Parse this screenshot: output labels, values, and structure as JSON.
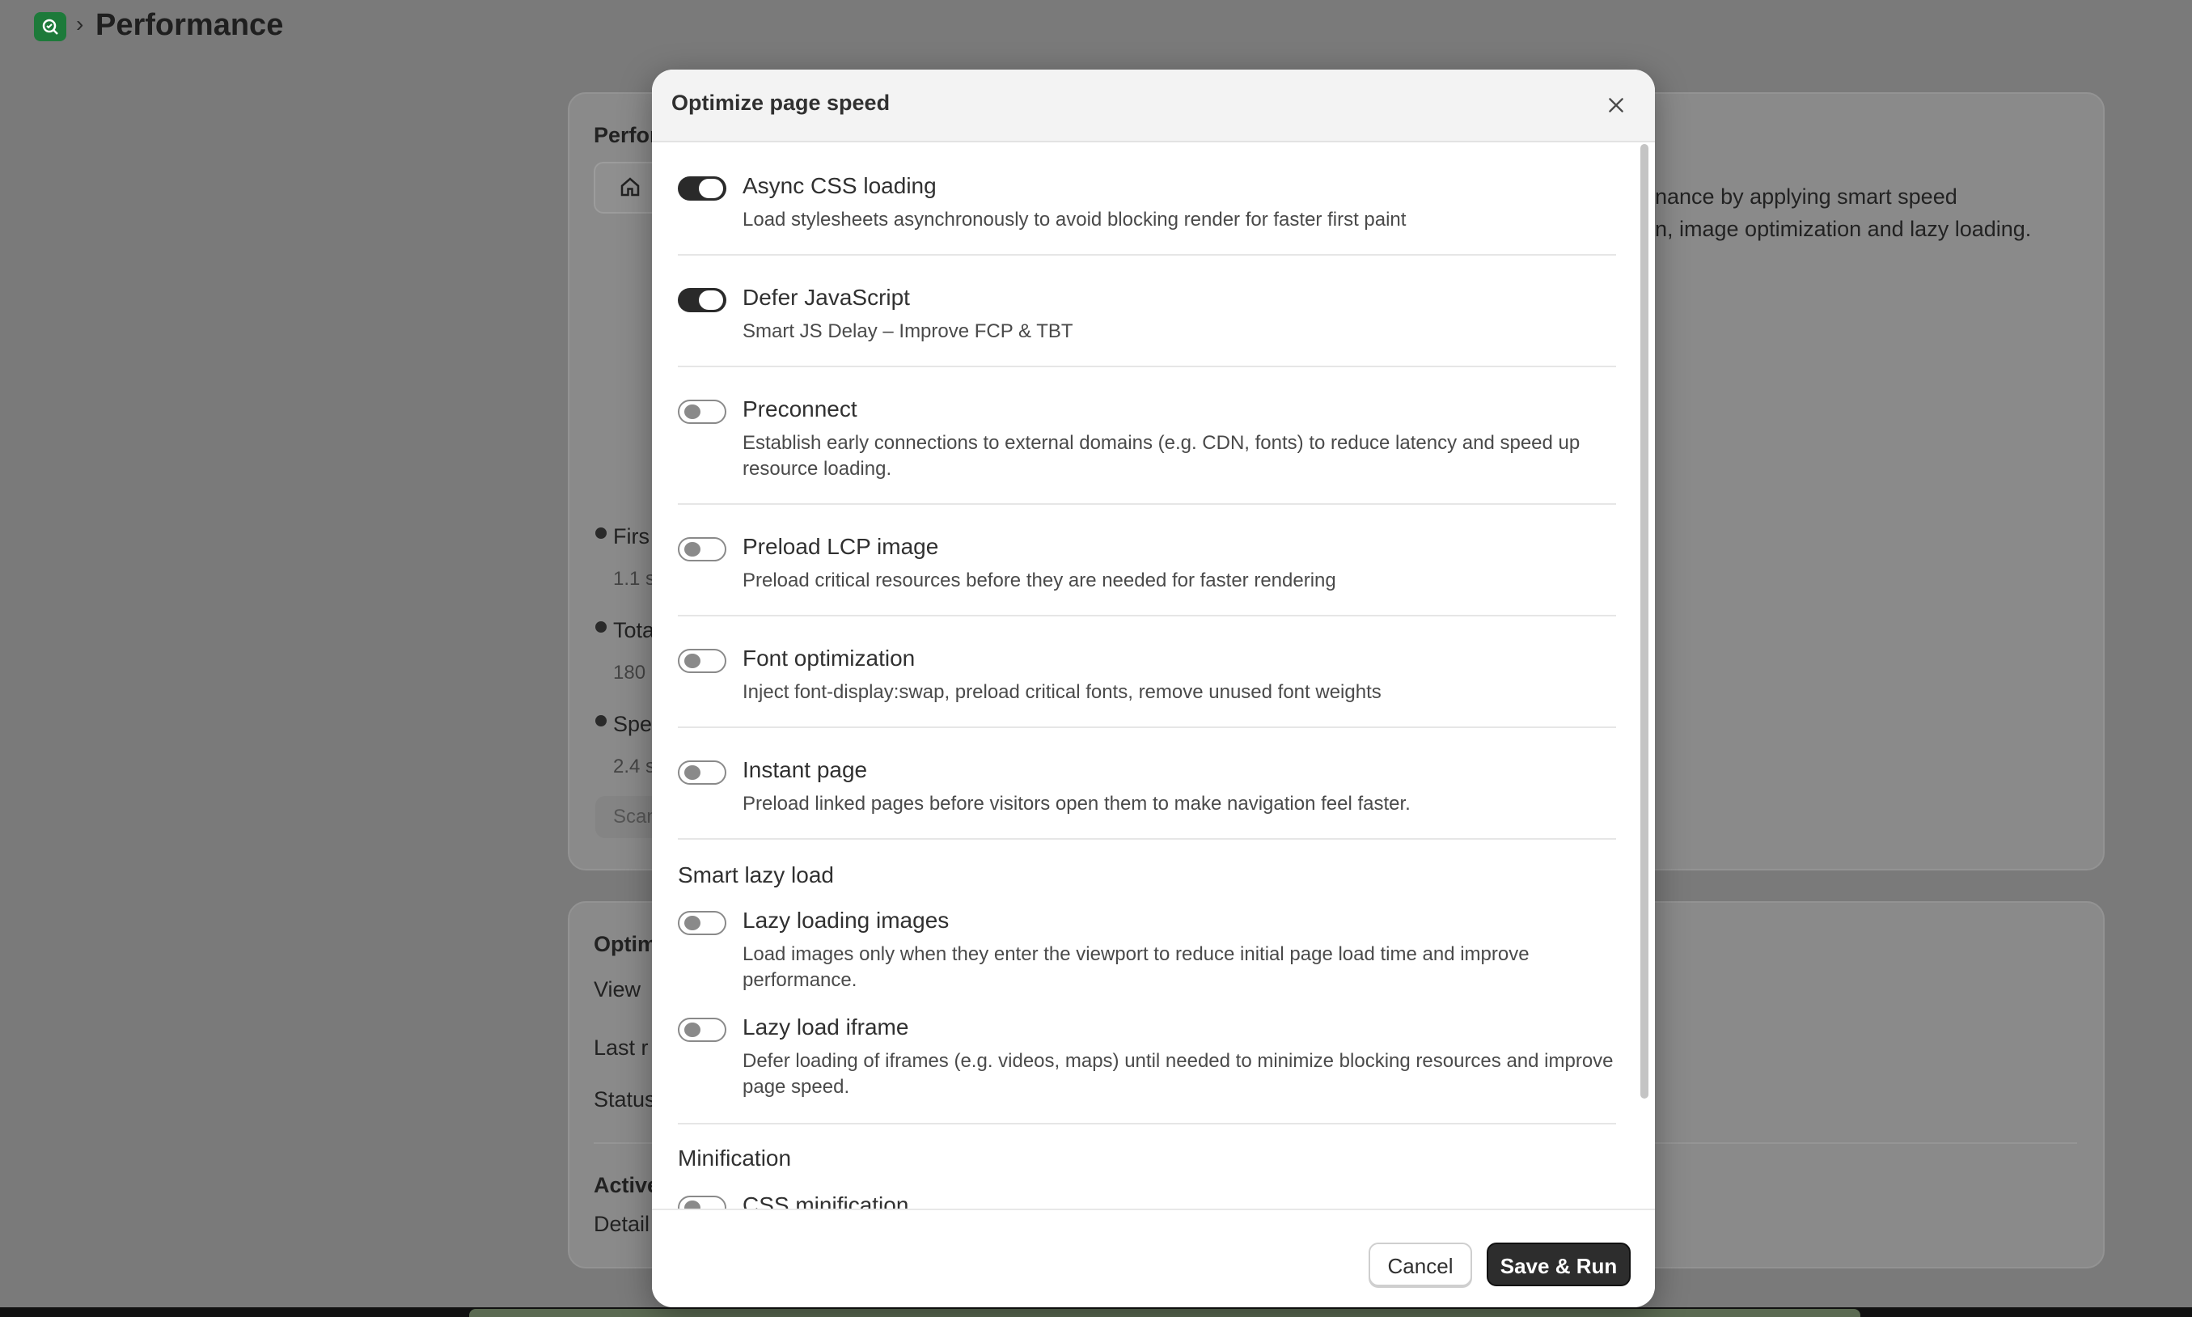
{
  "page": {
    "title": "Performance",
    "card1_title": "Perfor",
    "card1_desc_line1": "nance by applying smart speed",
    "card1_desc_line2": "n, image optimization and lazy loading.",
    "metrics": [
      {
        "label": "Firs",
        "value": "1.1 s"
      },
      {
        "label": "Tota",
        "value": "180"
      },
      {
        "label": "Spe",
        "value": "2.4 s"
      }
    ],
    "scan_button": "Scan",
    "card2_title": "Optim",
    "card2_view": "View",
    "last_run": "Last r",
    "status": "Status",
    "active": "Active",
    "details": "Detail"
  },
  "modal": {
    "title": "Optimize page speed",
    "options": [
      {
        "label": "Async CSS loading",
        "desc": "Load stylesheets asynchronously to avoid blocking render for faster first paint",
        "enabled": true
      },
      {
        "label": "Defer JavaScript",
        "desc": "Smart JS Delay – Improve FCP & TBT",
        "enabled": true
      },
      {
        "label": "Preconnect",
        "desc": "Establish early connections to external domains (e.g. CDN, fonts) to reduce latency and speed up resource loading.",
        "enabled": false
      },
      {
        "label": "Preload LCP image",
        "desc": "Preload critical resources before they are needed for faster rendering",
        "enabled": false
      },
      {
        "label": "Font optimization",
        "desc": "Inject font-display:swap, preload critical fonts, remove unused font weights",
        "enabled": false
      },
      {
        "label": "Instant page",
        "desc": "Preload linked pages before visitors open them to make navigation feel faster.",
        "enabled": false
      }
    ],
    "lazy_section": {
      "heading": "Smart lazy load",
      "options": [
        {
          "label": "Lazy loading images",
          "desc": "Load images only when they enter the viewport to reduce initial page load time and improve performance.",
          "enabled": false
        },
        {
          "label": "Lazy load iframe",
          "desc": "Defer loading of iframes (e.g. videos, maps) until needed to minimize blocking resources and improve page speed.",
          "enabled": false
        }
      ]
    },
    "minification_section": {
      "heading": "Minification",
      "options": [
        {
          "label": "CSS minification",
          "enabled": false
        }
      ]
    },
    "cancel_label": "Cancel",
    "save_label": "Save & Run"
  }
}
